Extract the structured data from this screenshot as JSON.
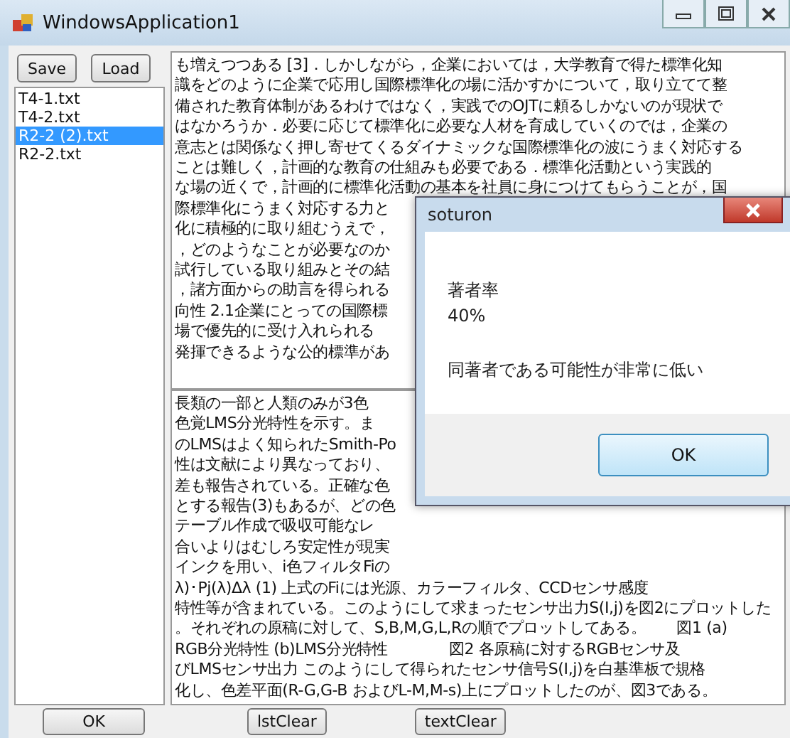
{
  "window": {
    "title": "WindowsApplication1"
  },
  "top_buttons": [
    "Save",
    "Load"
  ],
  "file_list": [
    {
      "name": "T4-1.txt",
      "selected": false
    },
    {
      "name": "T4-2.txt",
      "selected": false
    },
    {
      "name": "R2-2 (2).txt",
      "selected": true
    },
    {
      "name": "R2-2.txt",
      "selected": false
    }
  ],
  "upper_text": {
    "lines": [
      "も増えつつある [3]．しかしながら，企業においては，大学教育で得た標準化知",
      "識をどのように企業で応用し国際標準化の場に活かすかについて，取り立てて整",
      "備された教育体制があるわけではなく，実践でのOJTに頼るしかないのが現状で",
      "はなかろうか．必要に応じて標準化に必要な人材を育成していくのでは，企業の",
      "意志とは関係なく押し寄せてくるダイナミックな国際標準化の波にうまく対応する",
      "ことは難しく，計画的な教育の仕組みも必要である．標準化活動という実践的",
      "な場の近くで，計画的に標準化活動の基本を社員に身につけてもらうことが，国",
      "際標準化にうまく対応する力と",
      "化に積極的に取り組むうえで，",
      "，どのようなことが必要なのか",
      "試行している取り組みとその結",
      "，諸方面からの助言を得られる",
      "向性 2.1企業にとっての国際標",
      "場で優先的に受け入れられる",
      "発揮できるような公的標準があ"
    ]
  },
  "lower_text": {
    "lines": [
      "長類の一部と人類のみが3色",
      "色覚LMS分光特性を示す。ま",
      "のLMSはよく知られたSmith-Po",
      "性は文献により異なっており、",
      "差も報告されている。正確な色",
      "とする報告(3)もあるが、どの色",
      "テーブル作成で吸収可能なレ",
      "合いよりはむしろ安定性が現実",
      "インクを用い、i色フィルタFiの",
      "λ)･Pj(λ)Δλ (1)  上式のFiには光源、カラーフィルタ、CCDセンサ感度",
      "特性等が含まれている。このようにして求まったセンサ出力S(I,j)を図2にプロットした",
      "。それぞれの原稿に対して、S,B,M,G,L,Rの順でプロットしてある。　　図1 (a)",
      "RGB分光特性 (b)LMS分光特性　　　　図2 各原稿に対するRGBセンサ及",
      "びLMSセンサ出力  このようにして得られたセンサ信号S(I,j)を白基準板で規格",
      "化し、色差平面(R-G,G-B およびL-M,M-s)上にプロットしたのが、図3である。"
    ]
  },
  "bottom_buttons": [
    "OK",
    "lstClear",
    "textClear"
  ],
  "dialog": {
    "title": "soturon",
    "label": "著者率",
    "value": "40%",
    "message": "同著者である可能性が非常に低い",
    "button": "OK"
  }
}
